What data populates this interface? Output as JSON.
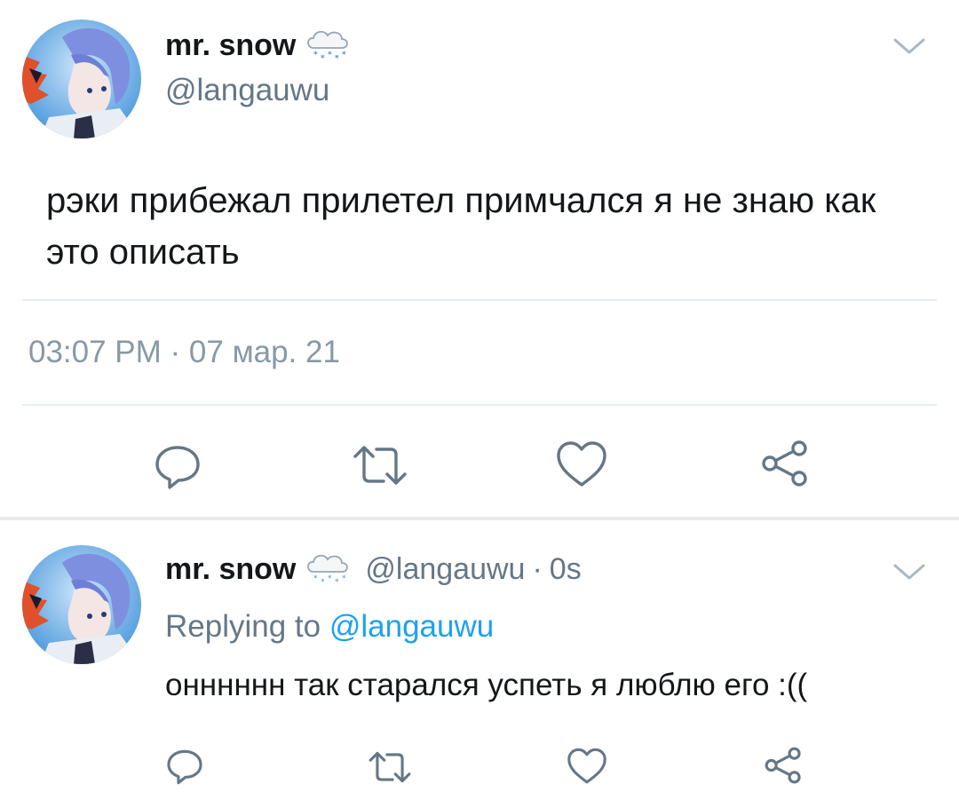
{
  "tweet": {
    "display_name": "mr. snow",
    "name_emoji": "cloud-with-snow",
    "handle": "@langauwu",
    "text": "рэки прибежал прилетел примчался я не знаю как это описать",
    "timestamp": "03:07 PM · 07 мар. 21",
    "actions": [
      "reply",
      "retweet",
      "like",
      "share"
    ]
  },
  "reply": {
    "display_name": "mr. snow",
    "name_emoji": "cloud-with-snow",
    "handle": "@langauwu",
    "separator": "·",
    "age": "0s",
    "replying_prefix": "Replying to",
    "replying_to": "@langauwu",
    "text": "онннннн так старался успеть я люблю его :((",
    "actions": [
      "reply",
      "retweet",
      "like",
      "share"
    ]
  },
  "colors": {
    "primary_text": "#14171a",
    "secondary_text": "#657786",
    "muted_text": "#8899a6",
    "link": "#1da1f2",
    "icon": "#657786",
    "divider": "#e6ecf0"
  }
}
